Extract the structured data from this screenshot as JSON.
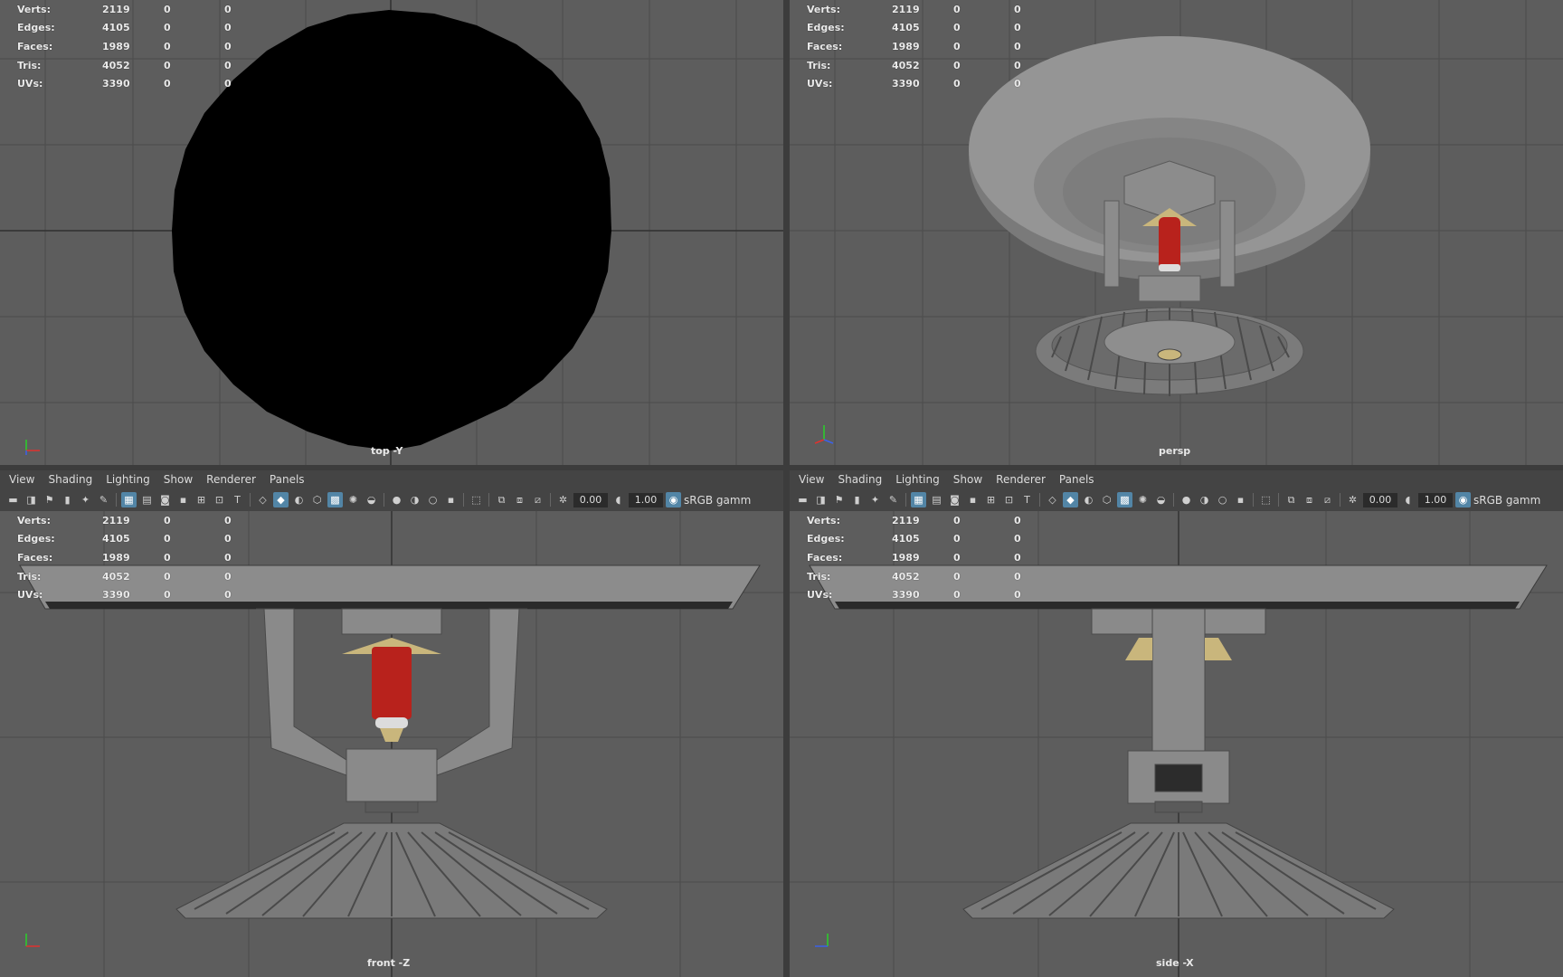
{
  "stats": {
    "rows": [
      {
        "label": "Verts:",
        "v1": "2119",
        "v2": "0",
        "v3": "0"
      },
      {
        "label": "Edges:",
        "v1": "4105",
        "v2": "0",
        "v3": "0"
      },
      {
        "label": "Faces:",
        "v1": "1989",
        "v2": "0",
        "v3": "0"
      },
      {
        "label": "Tris:",
        "v1": "4052",
        "v2": "0",
        "v3": "0"
      },
      {
        "label": "UVs:",
        "v1": "3390",
        "v2": "0",
        "v3": "0"
      }
    ]
  },
  "viewports": {
    "top": {
      "camera": "top -Y"
    },
    "persp": {
      "camera": "persp"
    },
    "front": {
      "camera": "front -Z"
    },
    "side": {
      "camera": "side -X"
    }
  },
  "menu": {
    "items": [
      "View",
      "Shading",
      "Lighting",
      "Show",
      "Renderer",
      "Panels"
    ]
  },
  "toolbar": {
    "exposure": "0.00",
    "gamma": "1.00",
    "color_space": "sRGB gamm"
  },
  "colors": {
    "viewport_bg": "#5d5d5d",
    "grid_line": "#4a4a4a",
    "metal": "#8a8a8a",
    "bulb_red": "#b8221c",
    "brass": "#c9b67c",
    "active_icon": "#5285a6"
  }
}
